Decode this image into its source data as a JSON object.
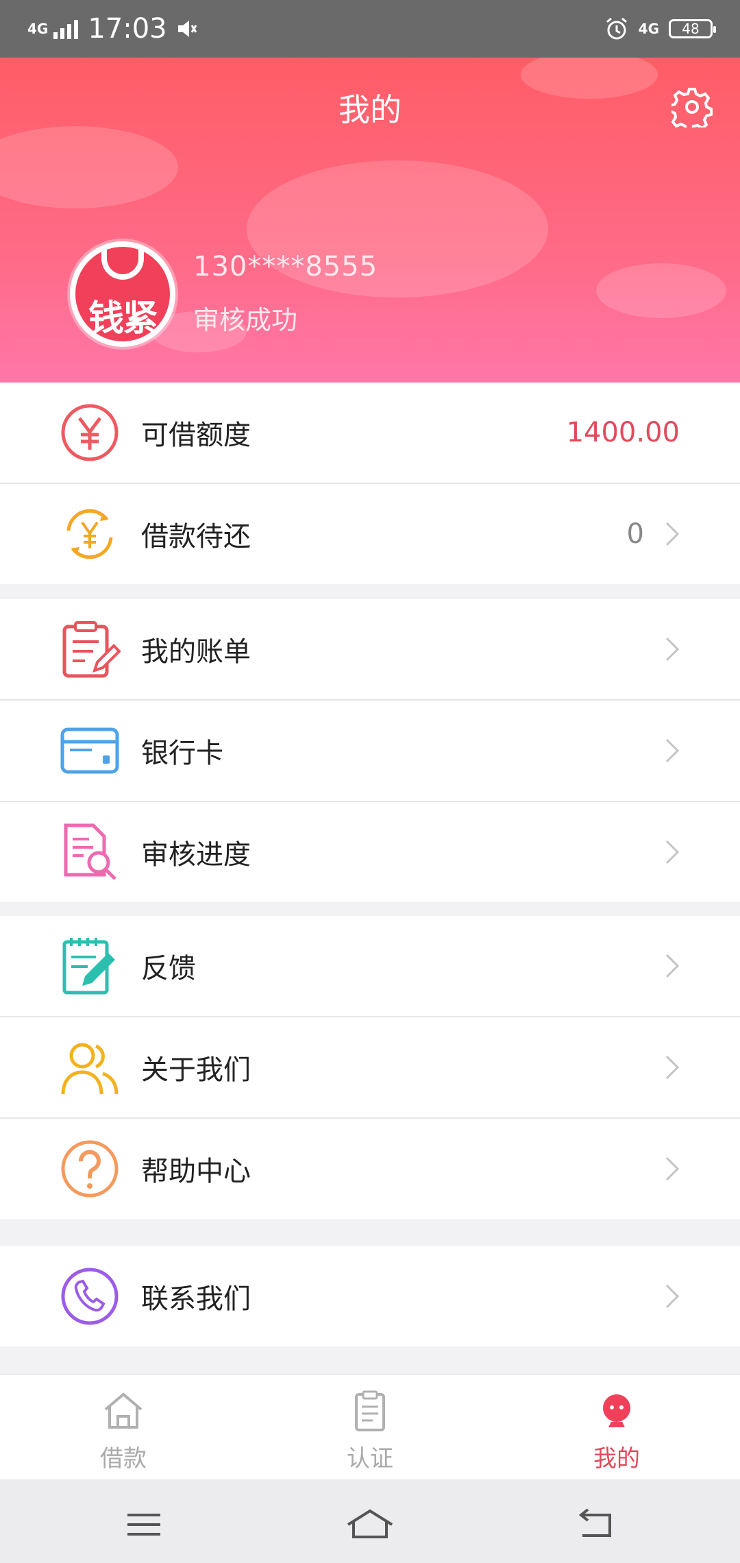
{
  "status_bar": {
    "network": "4G",
    "time": "17:03",
    "network_right": "4G",
    "battery": "48"
  },
  "header": {
    "title": "我的",
    "avatar_text": "钱紧",
    "phone": "130****8555",
    "status": "审核成功"
  },
  "menu": {
    "quota": {
      "label": "可借额度",
      "value": "1400.00"
    },
    "pending": {
      "label": "借款待还",
      "value": "0"
    },
    "bills": {
      "label": "我的账单"
    },
    "bank_card": {
      "label": "银行卡"
    },
    "review": {
      "label": "审核进度"
    },
    "feedback": {
      "label": "反馈"
    },
    "about": {
      "label": "关于我们"
    },
    "help": {
      "label": "帮助中心"
    },
    "contact": {
      "label": "联系我们"
    }
  },
  "tabs": [
    {
      "label": "借款",
      "icon": "home-icon"
    },
    {
      "label": "认证",
      "icon": "clipboard-icon"
    },
    {
      "label": "我的",
      "icon": "profile-icon",
      "active": true
    }
  ],
  "colors": {
    "accent": "#e04a5c",
    "header_top": "#ff5d66",
    "header_bottom": "#ff77a8"
  }
}
